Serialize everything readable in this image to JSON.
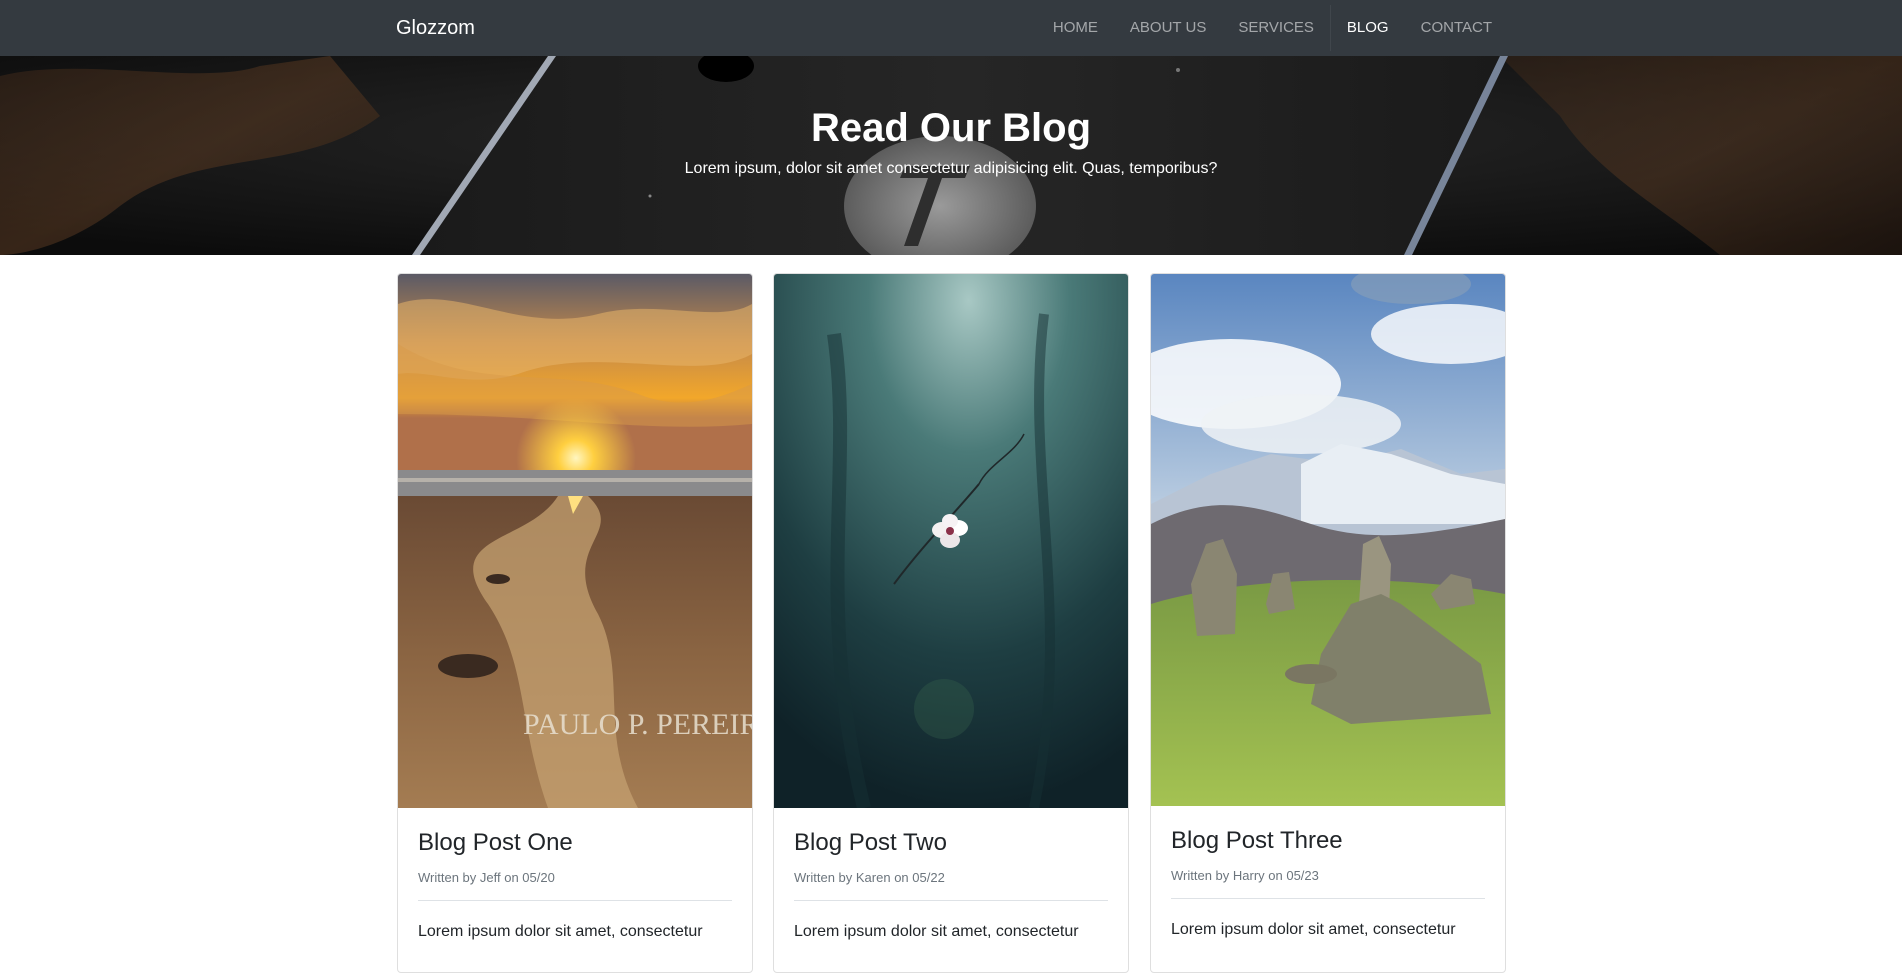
{
  "navbar": {
    "brand": "Glozzom",
    "links": [
      {
        "label": "HOME",
        "active": false
      },
      {
        "label": "ABOUT US",
        "active": false
      },
      {
        "label": "SERVICES",
        "active": false
      },
      {
        "label": "BLOG",
        "active": true
      },
      {
        "label": "CONTACT",
        "active": false
      }
    ]
  },
  "hero": {
    "title": "Read Our Blog",
    "subtitle": "Lorem ipsum, dolor sit amet consectetur adipisicing elit. Quas, temporibus?"
  },
  "posts": [
    {
      "title": "Blog Post One",
      "meta": "Written by Jeff on 05/20",
      "excerpt": "Lorem ipsum dolor sit amet, consectetur",
      "image": "sunset-beach-photo",
      "watermark": "PAULO P. PEREIRA"
    },
    {
      "title": "Blog Post Two",
      "meta": "Written by Karen on 05/22",
      "excerpt": "Lorem ipsum dolor sit amet, consectetur",
      "image": "white-flower-photo"
    },
    {
      "title": "Blog Post Three",
      "meta": "Written by Harry on 05/23",
      "excerpt": "Lorem ipsum dolor sit amet, consectetur",
      "image": "standing-stones-mountains-photo"
    }
  ]
}
